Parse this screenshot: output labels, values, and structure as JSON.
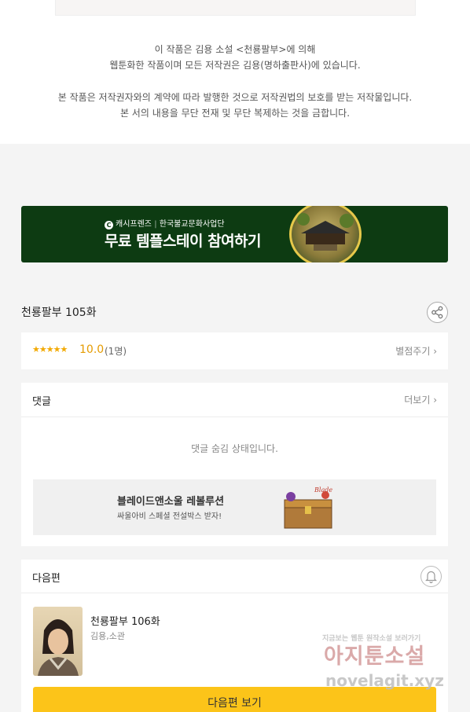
{
  "copyright": {
    "line1": "이 작품은 김용 소설 <천룡팔부>에 의해",
    "line2": "웹툰화한 작품이며 모든 저작권은 김용(명하출판사)에 있습니다.",
    "line3": "본 작품은 저작권자와의 계약에 따라 발행한 것으로 저작권법의 보호를 받는 저작물입니다.",
    "line4": "본 서의 내용을 무단 전재 및 무단 복제하는 것을 금합니다."
  },
  "banner": {
    "sub_brand": "캐시프렌즈",
    "sub_org": "한국불교문화사업단",
    "main": "무료 템플스테이 참여하기"
  },
  "episode": {
    "title": "천룡팔부 105화",
    "stars": "★★★★★",
    "score": "10.0",
    "count": "(1명)",
    "rate_link": "별점주기 ›"
  },
  "comments": {
    "title": "댓글",
    "more": "더보기 ›",
    "hidden_msg": "댓글 숨김 상태입니다.",
    "ad_title": "블레이드앤소울 레볼루션",
    "ad_sub": "싸울아비 스페셜 전설박스 받자!"
  },
  "next": {
    "title": "다음편",
    "episode": "천룡팔부 106화",
    "author": "김용,소관",
    "button": "다음편 보기"
  },
  "watermark": {
    "top": "지금보는 웹툰 원작소설 보러가기",
    "site": "아지툰소설",
    "url": "novelagit.xyz"
  }
}
